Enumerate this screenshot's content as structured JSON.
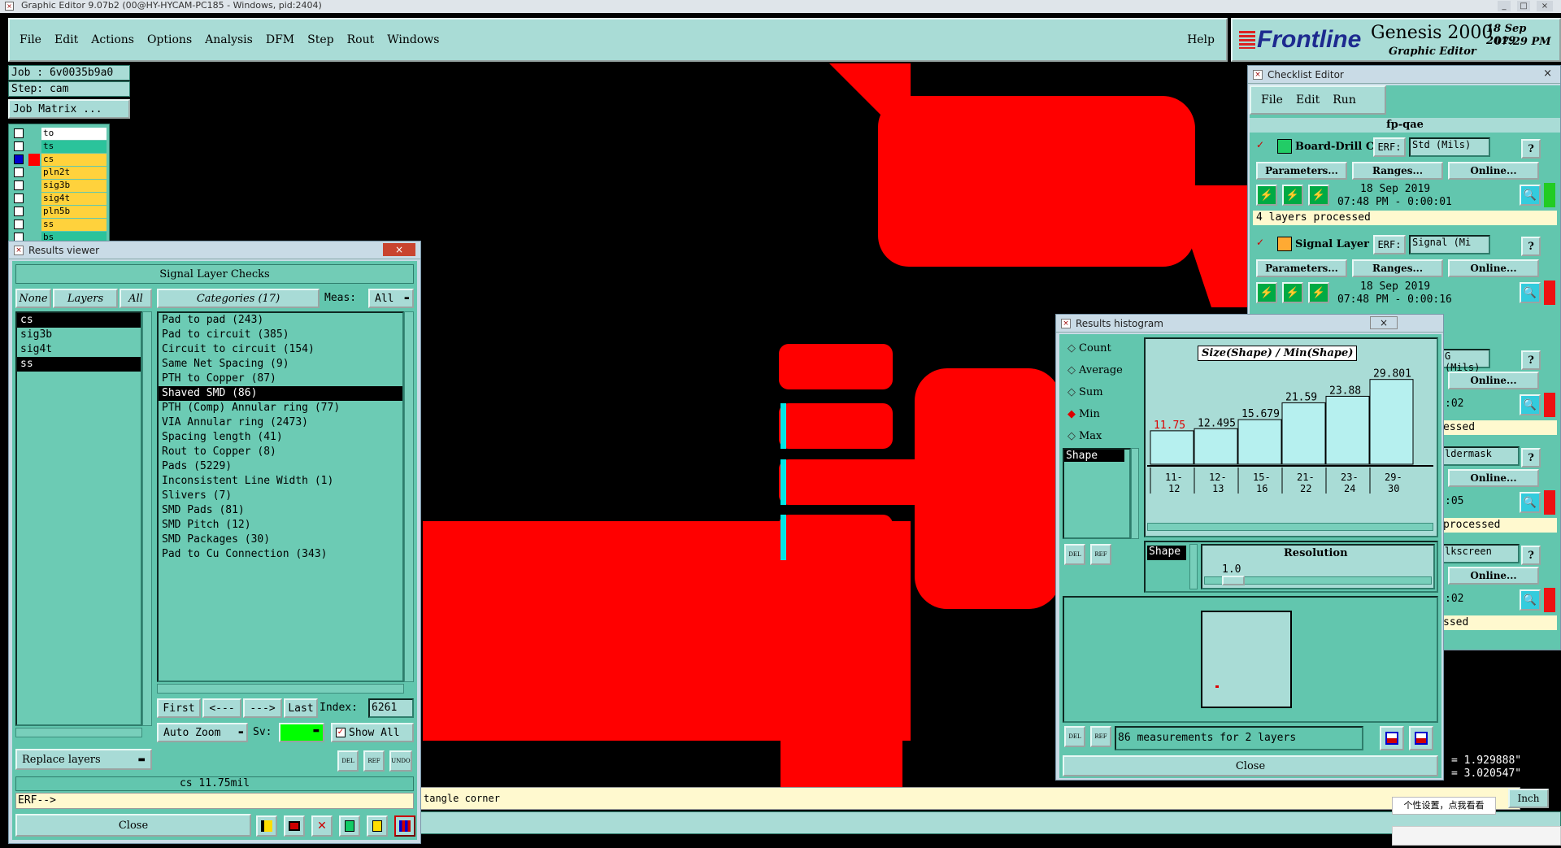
{
  "os_title": "Graphic Editor 9.07b2 (00@HY-HYCAM-PC185 - Windows, pid:2404)",
  "menu": [
    "File",
    "Edit",
    "Actions",
    "Options",
    "Analysis",
    "DFM",
    "Step",
    "Rout",
    "Windows"
  ],
  "help": "Help",
  "brand": {
    "logo": "Frontline",
    "product": "Genesis 2000",
    "subtitle": "Graphic Editor",
    "date": "18 Sep 2019",
    "time": "07:29 PM"
  },
  "job": {
    "job": "Job : 6v0035b9a0",
    "step": "Step: cam",
    "matrix": "Job Matrix ..."
  },
  "layers": [
    {
      "name": "to",
      "color": "#ffffff"
    },
    {
      "name": "ts",
      "color": "#2bc39b"
    },
    {
      "name": "cs",
      "color": "#ffd23c"
    },
    {
      "name": "pln2t",
      "color": "#ffd23c"
    },
    {
      "name": "sig3b",
      "color": "#ffd23c"
    },
    {
      "name": "sig4t",
      "color": "#ffd23c"
    },
    {
      "name": "pln5b",
      "color": "#ffd23c"
    },
    {
      "name": "ss",
      "color": "#ffd23c"
    },
    {
      "name": "bs",
      "color": "#2bc39b"
    }
  ],
  "results_viewer": {
    "title": "Results viewer",
    "heading": "Signal Layer Checks",
    "tabs": {
      "none": "None",
      "layers": "Layers",
      "all": "All"
    },
    "categories_btn": "Categories (17)",
    "meas_label": "Meas:",
    "meas_value": "All",
    "layer_list": [
      "cs",
      "sig3b",
      "sig4t",
      "ss"
    ],
    "categories": [
      "Pad to pad (243)",
      "Pad to circuit (385)",
      "Circuit to circuit (154)",
      "Same Net Spacing (9)",
      "PTH to Copper (87)",
      "Shaved SMD (86)",
      "PTH (Comp) Annular ring (77)",
      "VIA Annular ring (2473)",
      "Spacing length (41)",
      "Rout to Copper (8)",
      "Pads (5229)",
      "Inconsistent Line Width (1)",
      "Slivers (7)",
      "SMD Pads (81)",
      "SMD Pitch (12)",
      "SMD Packages (30)",
      "Pad to Cu Connection (343)"
    ],
    "nav": {
      "first": "First",
      "prev": "<---",
      "next": "--->",
      "last": "Last",
      "index_label": "Index:",
      "index_value": "6261"
    },
    "auto_zoom": "Auto Zoom",
    "sv_label": "Sv:",
    "show_all": "Show All",
    "replace_layers": "Replace layers",
    "del": "DEL",
    "ref": "REF",
    "undo": "UNDO",
    "status": "cs 11.75mil",
    "erf": "ERF-->",
    "close": "Close"
  },
  "canvas_status": "tangle corner",
  "checklist": {
    "title": "Checklist Editor",
    "menu": [
      "File",
      "Edit",
      "Run"
    ],
    "name": "fp-qae",
    "items": [
      {
        "name": "Board-Drill Che",
        "erf": "ERF:",
        "erf_value": "Std (Mils)",
        "params": "Parameters...",
        "ranges": "Ranges...",
        "online": "Online...",
        "date": "18 Sep 2019",
        "time": "07:48 PM - 0:00:01",
        "status": "4 layers processed"
      },
      {
        "name": "Signal Layer Ch",
        "erf": "ERF:",
        "erf_value": "Signal (Mi",
        "params": "Parameters...",
        "ranges": "Ranges...",
        "online": "Online...",
        "date": "18 Sep 2019",
        "time": "07:48 PM - 0:00:16",
        "status": ""
      }
    ],
    "partial": {
      "erf3": "G (Mils)",
      "online3": "Online...",
      "t3": ":02",
      "s3": "essed",
      "erf4": "ldermask",
      "online4": "Online...",
      "t4": ":05",
      "s4": "processed",
      "erf5": "lkscreen",
      "online5": "Online...",
      "t5": ":02",
      "s5": "ssed"
    }
  },
  "histogram": {
    "title": "Results histogram",
    "options": [
      "Count",
      "Average",
      "Sum",
      "Min",
      "Max"
    ],
    "selected_option": "Min",
    "shape_label": "Shape",
    "chart_title": "Size(Shape) / Min(Shape)",
    "bars": [
      {
        "label": "11.75",
        "value": 11.75,
        "range": "11-12"
      },
      {
        "label": "12.495",
        "value": 12.495,
        "range": "12-13"
      },
      {
        "label": "15.679",
        "value": 15.679,
        "range": "15-16"
      },
      {
        "label": "21.59",
        "value": 21.59,
        "range": "21-22"
      },
      {
        "label": "23.88",
        "value": 23.88,
        "range": "23-24"
      },
      {
        "label": "29.801",
        "value": 29.801,
        "range": "29-30"
      }
    ],
    "resolution_label": "Resolution",
    "resolution_value": "1.0",
    "shape_btn": "Shape",
    "measurements": "86 measurements for 2 layers",
    "del": "DEL",
    "ref": "REF",
    "close": "Close"
  },
  "coords": {
    "x": "= 1.929888\"",
    "y": "= 3.020547\""
  },
  "units": "Inch",
  "ime_tip": "个性设置，点我看看"
}
